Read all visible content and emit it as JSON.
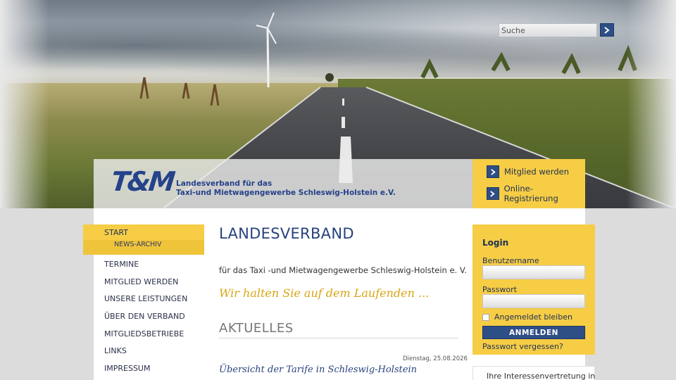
{
  "search": {
    "placeholder": "Suche",
    "button_icon": "arrow-right-icon"
  },
  "brand": {
    "logo": "T&M",
    "line1": "Landesverband für das",
    "line2": "Taxi-und Mietwagengewerbe Schleswig-Holstein e.V.",
    "color": "#25428a"
  },
  "quick_links": [
    {
      "label": "Mitglied werden",
      "icon": "arrow-right-icon"
    },
    {
      "label": "Online-Registrierung",
      "icon": "arrow-right-icon"
    }
  ],
  "nav": {
    "active": "START",
    "sub_active": "NEWS-ARCHIV",
    "items": [
      "TERMINE",
      "MITGLIED WERDEN",
      "UNSERE LEISTUNGEN",
      "ÜBER DEN VERBAND",
      "MITGLIEDSBETRIEBE",
      "LINKS",
      "IMPRESSUM"
    ]
  },
  "content": {
    "title": "LANDESVERBAND",
    "subline": "für das Taxi -und Mietwagengewerbe Schleswig-Holstein e. V.",
    "tagline": "Wir halten Sie auf dem Laufenden ...",
    "section_title": "AKTUELLES",
    "article_date": "Dienstag, 25.08.2026",
    "article_title": "Übersicht der Tarife in Schleswig-Holstein"
  },
  "login": {
    "title": "Login",
    "username_label": "Benutzername",
    "password_label": "Passwort",
    "remember_label": "Angemeldet bleiben",
    "submit_label": "ANMELDEN",
    "forgot_label": "Passwort vergessen?"
  },
  "promo": {
    "text": "Ihre Interessenvertretung in"
  },
  "colors": {
    "accent_yellow": "#f6cd45",
    "brand_blue": "#2e4e86",
    "tagline_gold": "#d9a514"
  }
}
